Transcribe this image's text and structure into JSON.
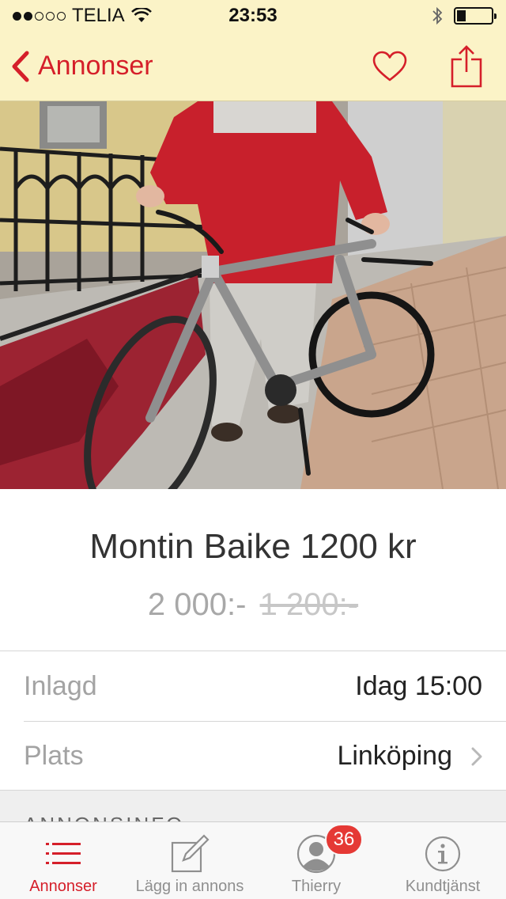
{
  "status_bar": {
    "carrier": "TELIA",
    "time": "23:53",
    "battery_level": 0.25
  },
  "nav": {
    "back_label": "Annonser",
    "icons": [
      "chevron-left-icon",
      "heart-icon",
      "share-icon"
    ]
  },
  "ad": {
    "title": "Montin Baike 1200 kr",
    "price": "2 000:-",
    "old_price": "1 200:-"
  },
  "details": [
    {
      "label": "Inlagd",
      "value": "Idag 15:00"
    },
    {
      "label": "Plats",
      "value": "Linköping"
    }
  ],
  "section_header": "ANNONSINFO",
  "tabbar": {
    "items": [
      {
        "label": "Annonser",
        "icon": "list-icon",
        "active": true
      },
      {
        "label": "Lägg in annons",
        "icon": "compose-icon"
      },
      {
        "label": "Thierry",
        "icon": "profile-icon",
        "badge": "36"
      },
      {
        "label": "Kundtjänst",
        "icon": "info-icon"
      }
    ]
  },
  "colors": {
    "accent": "#d51f2a",
    "bar_background": "#fbf3c7",
    "badge": "#e53935"
  }
}
